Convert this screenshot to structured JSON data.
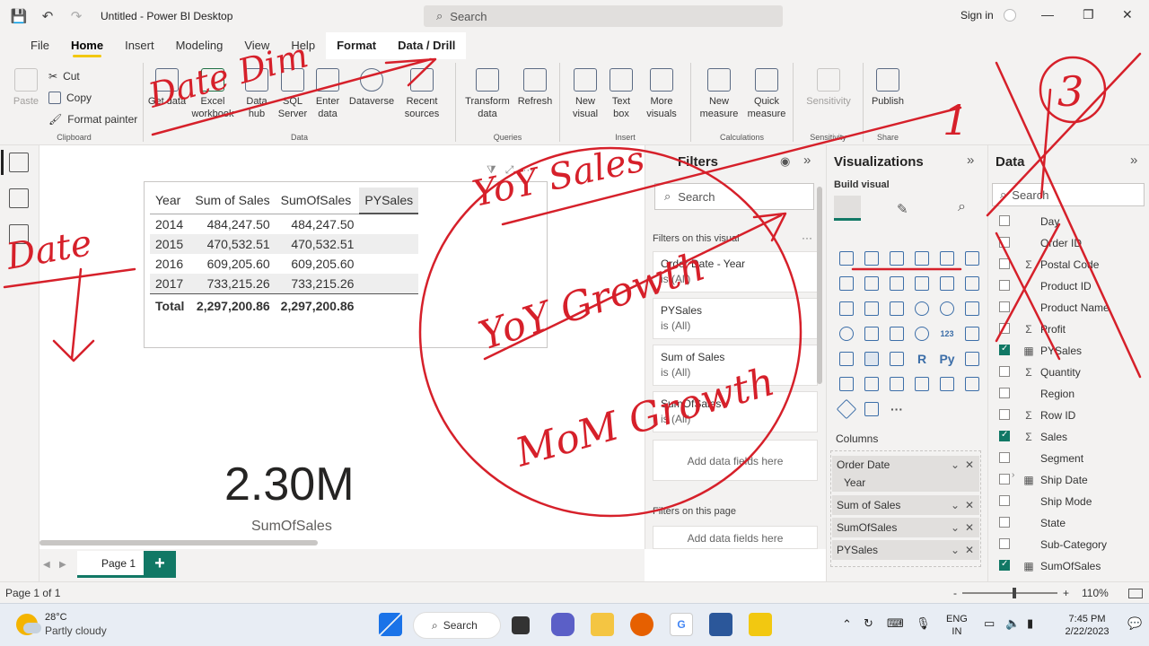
{
  "titlebar": {
    "title": "Untitled - Power BI Desktop",
    "search_placeholder": "Search",
    "signin": "Sign in"
  },
  "ribbon_tabs": [
    "File",
    "Home",
    "Insert",
    "Modeling",
    "View",
    "Help",
    "Format",
    "Data / Drill"
  ],
  "clipboard": {
    "paste": "Paste",
    "cut": "Cut",
    "copy": "Copy",
    "format_painter": "Format painter",
    "label": "Clipboard"
  },
  "data_group": {
    "get_data": "Get data",
    "excel": "Excel workbook",
    "hub": "Data hub",
    "sql": "SQL Server",
    "enter": "Enter data",
    "dataverse": "Dataverse",
    "recent": "Recent sources",
    "label": "Data"
  },
  "queries_group": {
    "transform": "Transform data",
    "refresh": "Refresh",
    "label": "Queries"
  },
  "insert_group": {
    "new_visual": "New visual",
    "text_box": "Text box",
    "more_visuals": "More visuals",
    "label": "Insert"
  },
  "calc_group": {
    "new_measure": "New measure",
    "quick_measure": "Quick measure",
    "label": "Calculations"
  },
  "sensitivity_group": {
    "sensitivity": "Sensitivity",
    "label": "Sensitivity"
  },
  "share_group": {
    "publish": "Publish",
    "label": "Share"
  },
  "table_visual": {
    "headers": [
      "Year",
      "Sum of Sales",
      "SumOfSales",
      "PYSales"
    ],
    "rows": [
      [
        "2014",
        "484,247.50",
        "484,247.50",
        ""
      ],
      [
        "2015",
        "470,532.51",
        "470,532.51",
        ""
      ],
      [
        "2016",
        "609,205.60",
        "609,205.60",
        ""
      ],
      [
        "2017",
        "733,215.26",
        "733,215.26",
        ""
      ]
    ],
    "total": [
      "Total",
      "2,297,200.86",
      "2,297,200.86",
      ""
    ]
  },
  "card_visual": {
    "value": "2.30M",
    "label": "SumOfSales"
  },
  "pages": {
    "tab": "Page 1",
    "add": "+"
  },
  "filters": {
    "title": "Filters",
    "search": "Search",
    "on_visual": "Filters on this visual",
    "cards": [
      {
        "name": "Order Date - Year",
        "state": "is (All)"
      },
      {
        "name": "PYSales",
        "state": "is (All)"
      },
      {
        "name": "Sum of Sales",
        "state": "is (All)"
      },
      {
        "name": "SumOfSales",
        "state": "is (All)"
      }
    ],
    "add_fields": "Add data fields here",
    "on_page": "Filters on this page",
    "add_fields_page": "Add data fields here"
  },
  "visualizations": {
    "title": "Visualizations",
    "build_visual": "Build visual",
    "columns_label": "Columns",
    "wells": [
      {
        "name": "Order Date",
        "sub": "Year"
      },
      {
        "name": "Sum of Sales"
      },
      {
        "name": "SumOfSales"
      },
      {
        "name": "PYSales"
      }
    ],
    "grid_text": [
      "123",
      "R",
      "Py",
      "···"
    ]
  },
  "data_pane": {
    "title": "Data",
    "search": "Search",
    "fields": [
      {
        "name": "Day",
        "type": "",
        "checked": false
      },
      {
        "name": "Order ID",
        "type": "",
        "checked": false
      },
      {
        "name": "Postal Code",
        "type": "Σ",
        "checked": false
      },
      {
        "name": "Product ID",
        "type": "",
        "checked": false
      },
      {
        "name": "Product Name",
        "type": "",
        "checked": false
      },
      {
        "name": "Profit",
        "type": "Σ",
        "checked": false
      },
      {
        "name": "PYSales",
        "type": "▦",
        "checked": true
      },
      {
        "name": "Quantity",
        "type": "Σ",
        "checked": false
      },
      {
        "name": "Region",
        "type": "",
        "checked": false
      },
      {
        "name": "Row ID",
        "type": "Σ",
        "checked": false
      },
      {
        "name": "Sales",
        "type": "Σ",
        "checked": true
      },
      {
        "name": "Segment",
        "type": "",
        "checked": false
      },
      {
        "name": "Ship Date",
        "type": "▦",
        "checked": false
      },
      {
        "name": "Ship Mode",
        "type": "",
        "checked": false
      },
      {
        "name": "State",
        "type": "",
        "checked": false
      },
      {
        "name": "Sub-Category",
        "type": "",
        "checked": false
      },
      {
        "name": "SumOfSales",
        "type": "▦",
        "checked": true
      }
    ]
  },
  "statusbar": {
    "page": "Page 1 of 1",
    "zoom": "110%",
    "minus": "-",
    "plus": "+"
  },
  "taskbar": {
    "temp": "28°C",
    "weather": "Partly cloudy",
    "search": "Search",
    "lang1": "ENG",
    "lang2": "IN",
    "time": "7:45 PM",
    "date": "2/22/2023"
  },
  "annotations": {
    "color": "#d6202a",
    "texts": [
      "YoY Sales",
      "YoY Growth",
      "MoM Growth",
      "Date Dim",
      "Date",
      "1",
      "3"
    ]
  }
}
